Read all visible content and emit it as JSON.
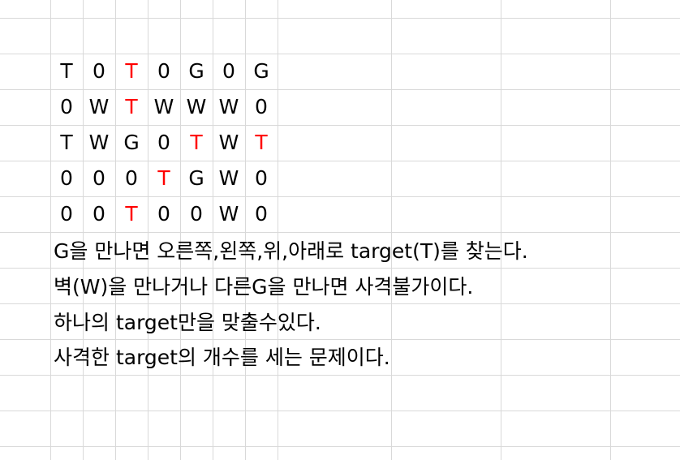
{
  "grid": {
    "rows": [
      [
        "T",
        "0",
        "T",
        "0",
        "G",
        "0",
        "G"
      ],
      [
        "0",
        "W",
        "T",
        "W",
        "W",
        "W",
        "0"
      ],
      [
        "T",
        "W",
        "G",
        "0",
        "T",
        "W",
        "T"
      ],
      [
        "0",
        "0",
        "0",
        "T",
        "G",
        "W",
        "0"
      ],
      [
        "0",
        "0",
        "T",
        "0",
        "0",
        "W",
        "0"
      ]
    ],
    "red_cells": [
      [
        0,
        2
      ],
      [
        1,
        2
      ],
      [
        2,
        4
      ],
      [
        2,
        6
      ],
      [
        3,
        3
      ],
      [
        4,
        2
      ]
    ]
  },
  "description": [
    "G을 만나면 오른쪽,왼쪽,위,아래로 target(T)를 찾는다.",
    "벽(W)을 만나거나 다른G을 만나면 사격불가이다.",
    "하나의 target만을 맞출수있다.",
    "사격한 target의 개수를 세는 문제이다."
  ],
  "colors": {
    "text": "#000000",
    "target": "#ff0000",
    "gridline": "#d9d9d9",
    "background": "#ffffff"
  }
}
